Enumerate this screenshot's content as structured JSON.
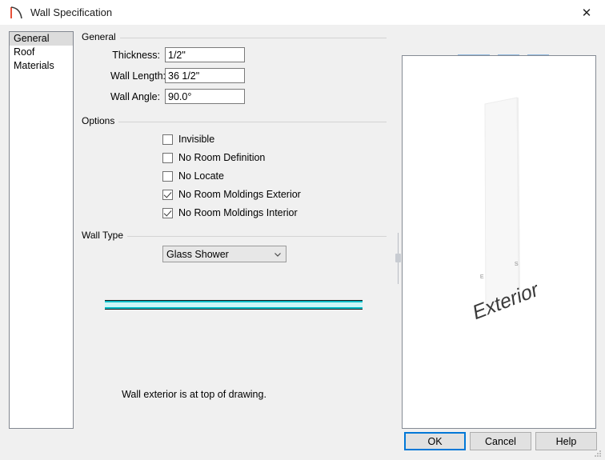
{
  "window": {
    "title": "Wall Specification",
    "icon": "wall-curve-icon",
    "close_label": "✕"
  },
  "sidebar": {
    "items": [
      {
        "label": "General",
        "selected": true
      },
      {
        "label": "Roof",
        "selected": false
      },
      {
        "label": "Materials",
        "selected": false
      }
    ]
  },
  "general_group": {
    "title": "General",
    "fields": [
      {
        "label": "Thickness:",
        "value": "1/2\""
      },
      {
        "label": "Wall Length:",
        "value": "36 1/2\""
      },
      {
        "label": "Wall Angle:",
        "value": "90.0°"
      }
    ]
  },
  "options_group": {
    "title": "Options",
    "checkboxes": [
      {
        "label": "Invisible",
        "checked": false
      },
      {
        "label": "No Room Definition",
        "checked": false
      },
      {
        "label": "No Locate",
        "checked": false
      },
      {
        "label": "No Room Moldings Exterior",
        "checked": true
      },
      {
        "label": "No Room Moldings Interior",
        "checked": true
      }
    ]
  },
  "wall_type_group": {
    "title": "Wall Type",
    "selected": "Glass Shower",
    "options": [
      "Glass Shower"
    ],
    "chevron_icon": "chevron-down-icon",
    "section_fill_color": "#cbf7f8",
    "section_edge_color": "#00b9c4",
    "hint": "Wall exterior is at top of drawing."
  },
  "toolbar": {
    "buttons": [
      {
        "name": "show-house-toggle",
        "icon": "house-checkbox-icon",
        "has_dropdown": true
      },
      {
        "name": "fill-window-button",
        "icon": "fit-to-window-icon",
        "has_dropdown": false
      },
      {
        "name": "show-wall-toggle",
        "icon": "wall-checkbox-icon",
        "has_dropdown": false
      }
    ]
  },
  "preview": {
    "label_exterior": "Exterior",
    "label_far_e": "E",
    "label_far_s": "S",
    "wall_face_color": "#f6f6f6"
  },
  "footer": {
    "ok_label": "OK",
    "cancel_label": "Cancel",
    "help_label": "Help"
  }
}
